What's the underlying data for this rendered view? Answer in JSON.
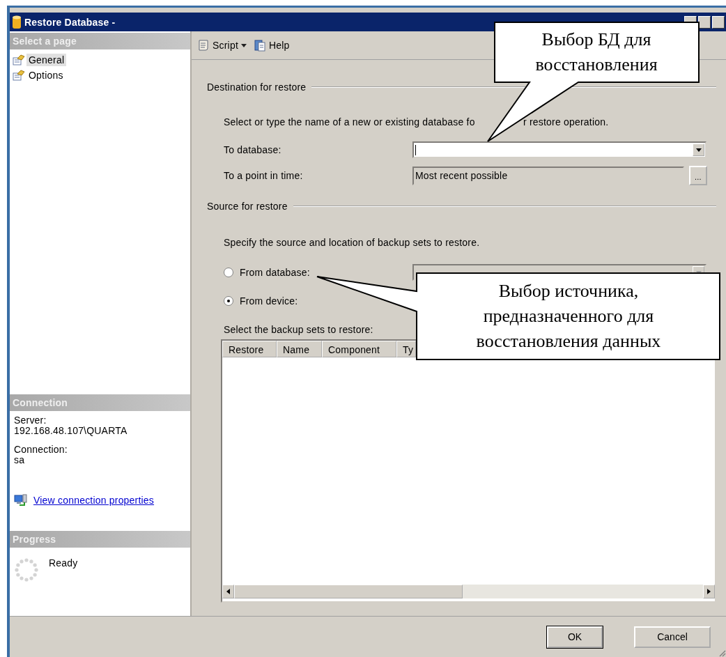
{
  "window": {
    "title": "Restore Database -"
  },
  "sidebar": {
    "heading": "Select a page",
    "pages": [
      {
        "label": "General",
        "selected": true
      },
      {
        "label": "Options",
        "selected": false
      }
    ],
    "connection": {
      "heading": "Connection",
      "server_label": "Server:",
      "server": "192.168.48.107\\QUARTA",
      "connection_label": "Connection:",
      "connection": "sa",
      "link": "View connection properties"
    },
    "progress": {
      "heading": "Progress",
      "status": "Ready"
    }
  },
  "toolbar": [
    {
      "label": "Script",
      "kind": "dropdown"
    },
    {
      "label": "Help",
      "kind": "button"
    }
  ],
  "destination": {
    "heading": "Destination for restore",
    "description_start": "Select or type the name of a new or existing database fo",
    "description_end": "r restore operation.",
    "to_database_label": "To database:",
    "point_in_time_label": "To a point in time:",
    "point_in_time": "Most recent possible",
    "browse": "..."
  },
  "source": {
    "heading": "Source for restore",
    "description": "Specify the source and location of backup sets to restore.",
    "options": [
      {
        "label": "From database:",
        "selected": false
      },
      {
        "label": "From device:",
        "selected": true
      }
    ],
    "backup_label": "Select the backup sets to restore:",
    "columns": [
      "Restore",
      "Name",
      "Component",
      "Ty"
    ]
  },
  "buttons": [
    {
      "label": "OK",
      "default": true
    },
    {
      "label": "Cancel",
      "default": false
    }
  ],
  "callouts": [
    {
      "text": "Выбор БД для восстановления"
    },
    {
      "text": "Выбор источника, предназначенного для восстановления данных"
    }
  ]
}
